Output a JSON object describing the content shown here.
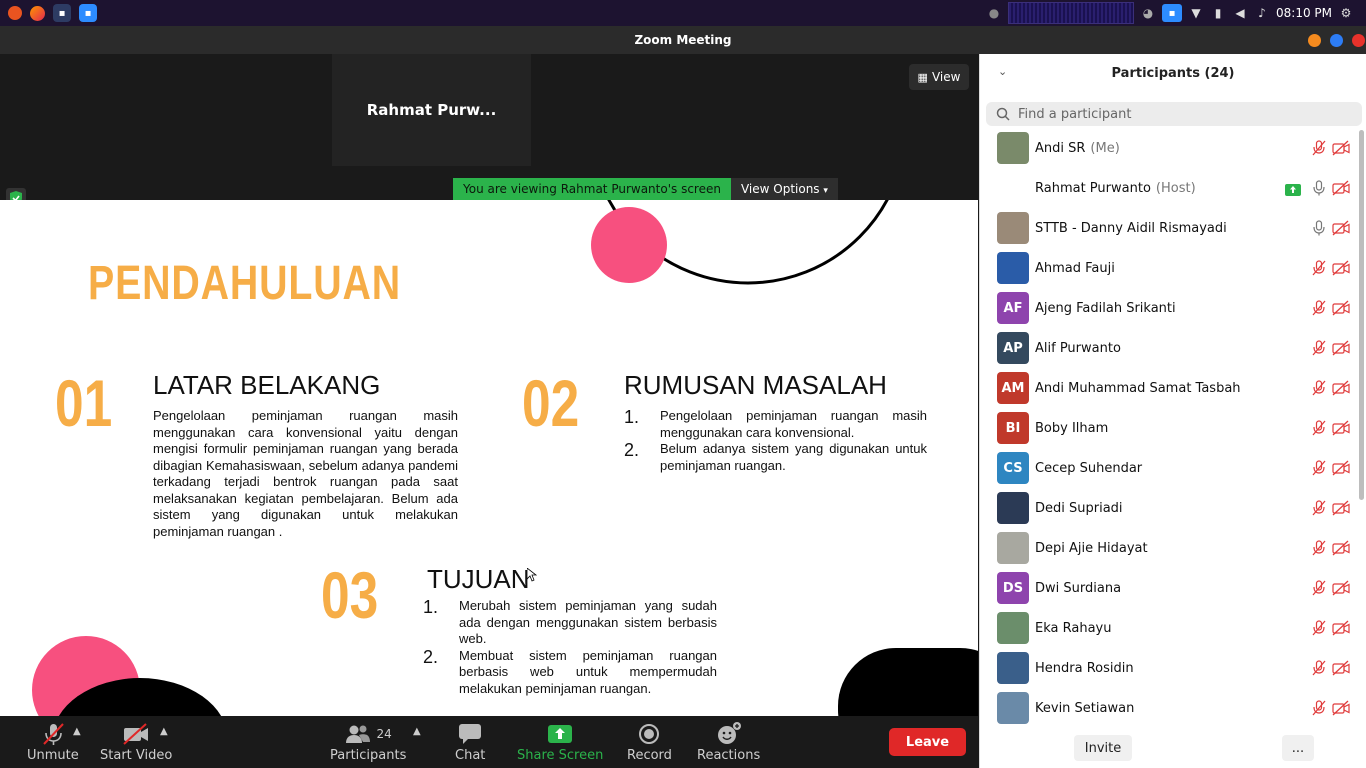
{
  "system": {
    "time": "08:10 PM",
    "launcher_icons": [
      "ubuntu-icon",
      "firefox-icon",
      "zoom-icon",
      "zoom-active-icon"
    ]
  },
  "window": {
    "title": "Zoom Meeting"
  },
  "meeting": {
    "tile_name": "Rahmat Purw...",
    "view_label": "View",
    "viewing_text": "You are viewing Rahmat Purwanto's screen",
    "view_options_label": "View Options"
  },
  "slide": {
    "title": "PENDAHULUAN",
    "sections": [
      {
        "number": "01",
        "heading": "LATAR BELAKANG",
        "body": "Pengelolaan peminjaman ruangan masih menggunakan cara konvensional yaitu dengan mengisi formulir peminjaman ruangan yang berada dibagian Kemahasiswaan, sebelum adanya pandemi terkadang terjadi bentrok ruangan pada saat melaksanakan kegiatan pembelajaran. Belum ada sistem yang digunakan untuk melakukan peminjaman ruangan ."
      },
      {
        "number": "02",
        "heading": "RUMUSAN MASALAH",
        "items": [
          {
            "n": "1.",
            "text": "Pengelolaan peminjaman ruangan masih menggunakan cara konvensional."
          },
          {
            "n": "2.",
            "text": "Belum adanya sistem yang digunakan untuk peminjaman ruangan."
          }
        ]
      },
      {
        "number": "03",
        "heading": "TUJUAN",
        "items": [
          {
            "n": "1.",
            "text": "Merubah sistem peminjaman yang sudah ada dengan menggunakan sistem berbasis web."
          },
          {
            "n": "2.",
            "text": "Membuat sistem peminjaman ruangan berbasis web untuk mempermudah melakukan peminjaman ruangan."
          }
        ]
      }
    ]
  },
  "toolbar": {
    "unmute": "Unmute",
    "start_video": "Start Video",
    "participants_count": "24",
    "participants": "Participants",
    "chat": "Chat",
    "share_screen": "Share Screen",
    "record": "Record",
    "reactions": "Reactions",
    "leave": "Leave"
  },
  "panel": {
    "title": "Participants (24)",
    "search_placeholder": "Find a participant",
    "invite": "Invite",
    "more": "...",
    "participants": [
      {
        "name": "Andi SR",
        "role": "(Me)",
        "initials": "",
        "color": "#7a8a6a",
        "audio": "muted",
        "share": false
      },
      {
        "name": "Rahmat Purwanto",
        "role": "(Host)",
        "initials": "",
        "color": "",
        "audio": "on",
        "share": true
      },
      {
        "name": "STTB - Danny Aidil Rismayadi",
        "role": "",
        "initials": "",
        "color": "#9a8a78",
        "audio": "on",
        "share": false
      },
      {
        "name": "Ahmad Fauji",
        "role": "",
        "initials": "",
        "color": "#2a5ca8",
        "audio": "muted",
        "share": false
      },
      {
        "name": "Ajeng Fadilah Srikanti",
        "role": "",
        "initials": "AF",
        "color": "#8e44ad",
        "audio": "muted",
        "share": false
      },
      {
        "name": "Alif Purwanto",
        "role": "",
        "initials": "AP",
        "color": "#34495e",
        "audio": "muted",
        "share": false
      },
      {
        "name": "Andi Muhammad Samat Tasbah",
        "role": "",
        "initials": "AM",
        "color": "#c0392b",
        "audio": "muted",
        "share": false
      },
      {
        "name": "Boby Ilham",
        "role": "",
        "initials": "BI",
        "color": "#c0392b",
        "audio": "muted",
        "share": false
      },
      {
        "name": "Cecep Suhendar",
        "role": "",
        "initials": "CS",
        "color": "#2e86c1",
        "audio": "muted",
        "share": false
      },
      {
        "name": "Dedi Supriadi",
        "role": "",
        "initials": "",
        "color": "#2b3a55",
        "audio": "muted",
        "share": false
      },
      {
        "name": "Depi Ajie Hidayat",
        "role": "",
        "initials": "",
        "color": "#a8a8a0",
        "audio": "muted",
        "share": false
      },
      {
        "name": "Dwi Surdiana",
        "role": "",
        "initials": "DS",
        "color": "#8e44ad",
        "audio": "muted",
        "share": false
      },
      {
        "name": "Eka Rahayu",
        "role": "",
        "initials": "",
        "color": "#6b8e6b",
        "audio": "muted",
        "share": false
      },
      {
        "name": "Hendra Rosidin",
        "role": "",
        "initials": "",
        "color": "#3a5f8a",
        "audio": "muted",
        "share": false
      },
      {
        "name": "Kevin Setiawan",
        "role": "",
        "initials": "",
        "color": "#6a8aa8",
        "audio": "muted",
        "share": false
      }
    ]
  },
  "colors": {
    "accent_orange": "#f6ad47",
    "pink": "#f7507f",
    "leave_red": "#e02828",
    "share_green": "#2bb34b"
  }
}
